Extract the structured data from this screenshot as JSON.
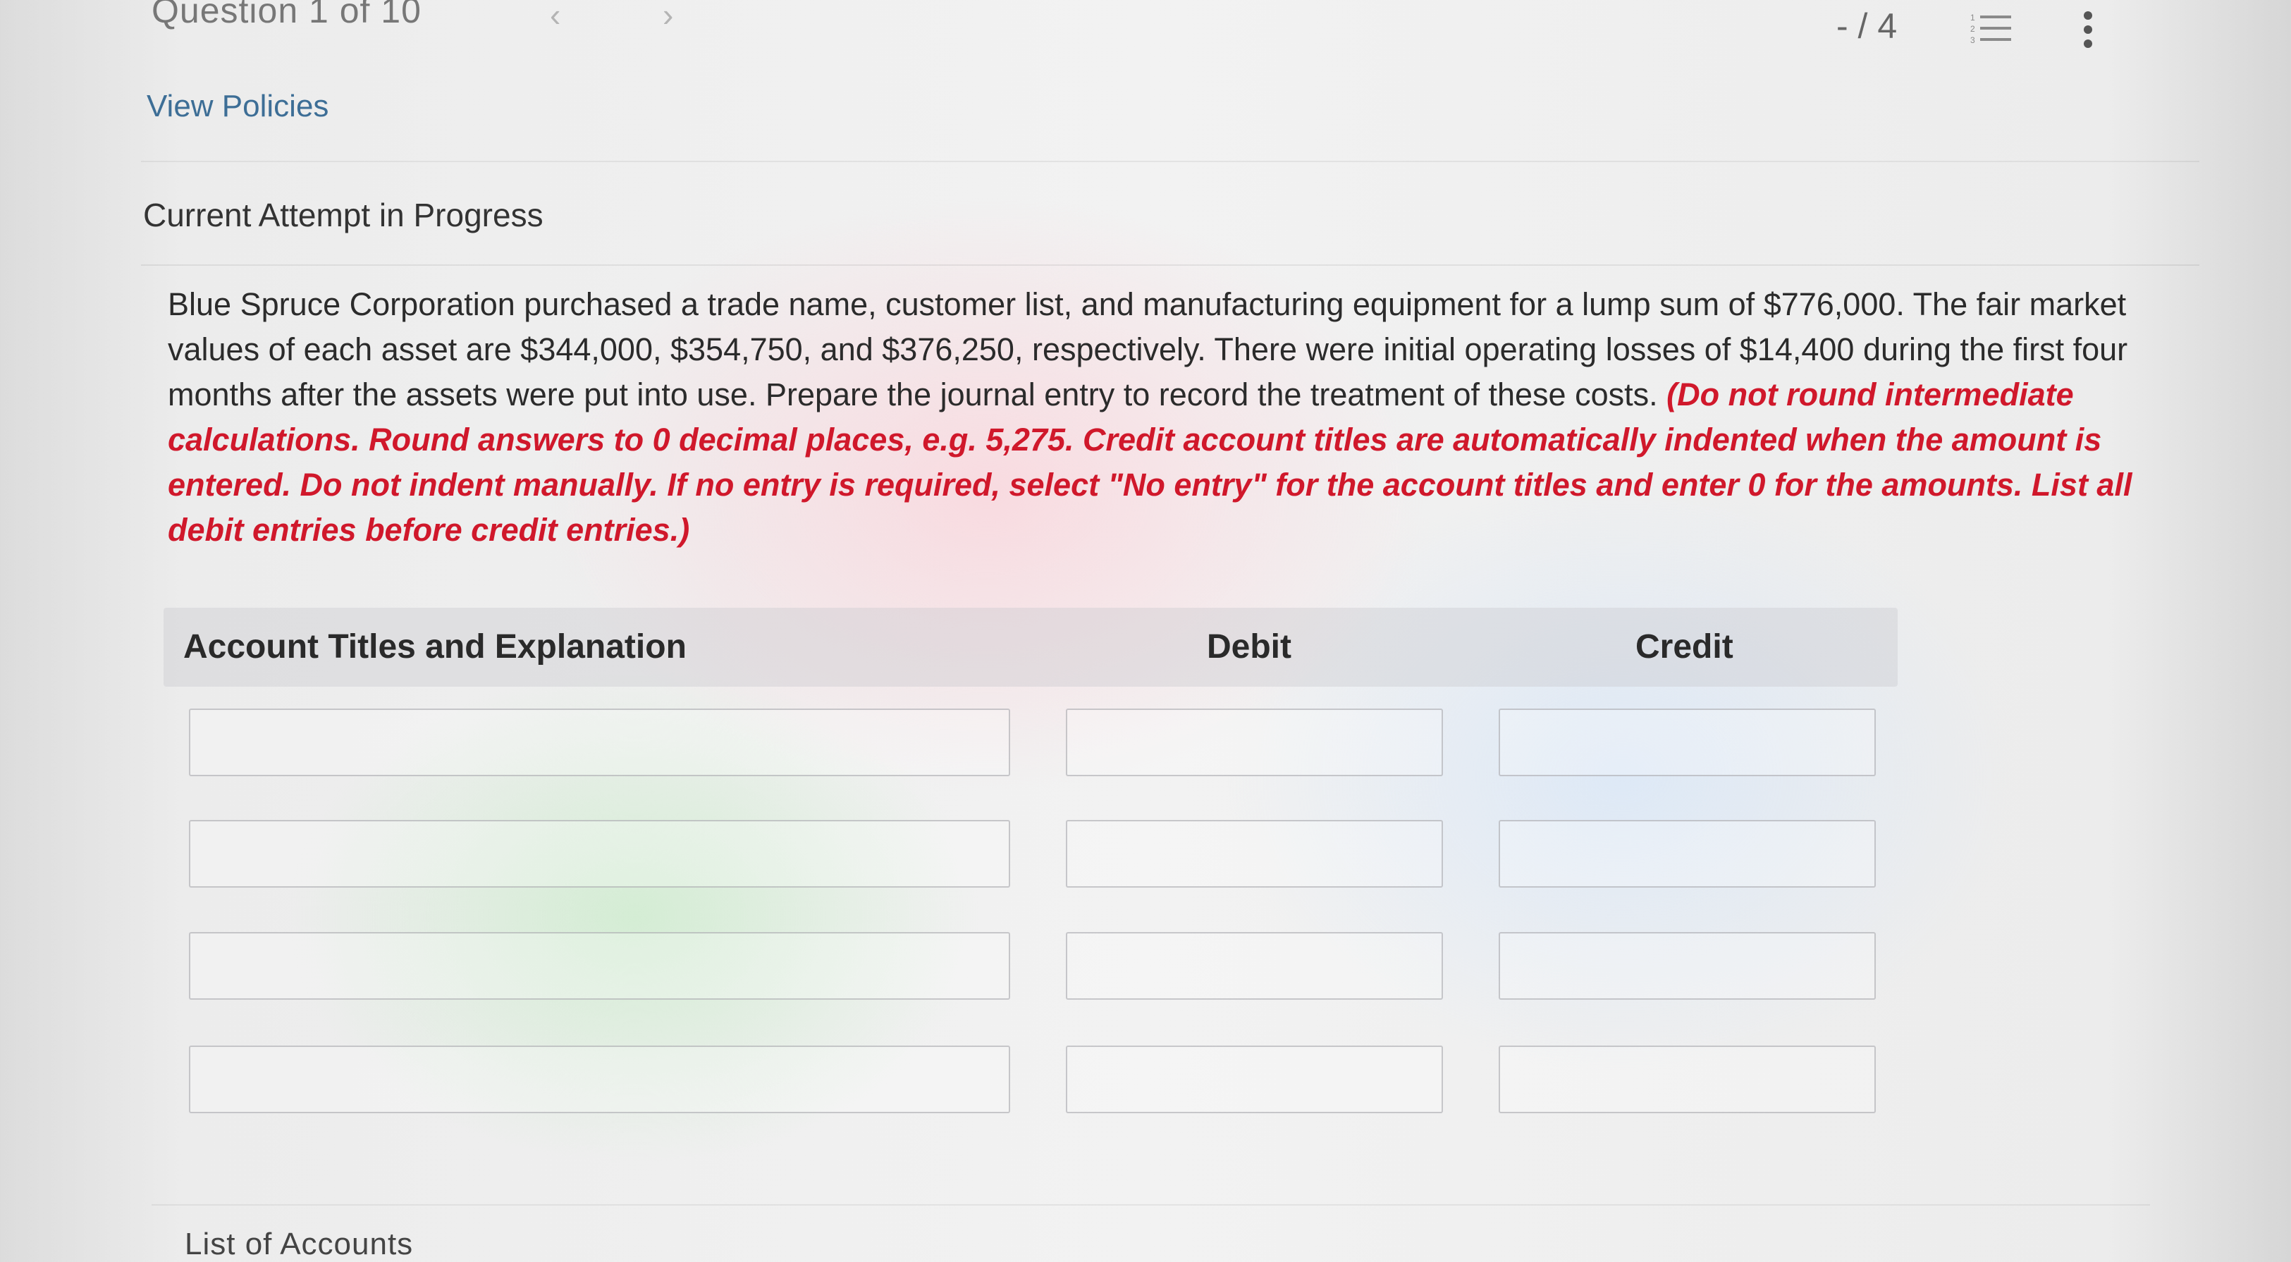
{
  "header": {
    "question_counter": "Question 1 of 10",
    "prev_glyph": "‹",
    "next_glyph": "›",
    "score": "- / 4",
    "list_icon": "numbered-list-icon",
    "more_icon": "vertical-ellipsis-icon"
  },
  "policies_link": "View Policies",
  "attempt_heading": "Current Attempt in Progress",
  "question": {
    "body": "Blue Spruce Corporation purchased a trade name, customer list, and manufacturing equipment for a lump sum of $776,000. The fair market values of each asset are $344,000, $354,750, and $376,250, respectively. There were initial operating losses of $14,400 during the first four months after the assets were put into use. Prepare the journal entry to record the treatment of these costs.",
    "instructions": "(Do not round intermediate calculations. Round answers to 0 decimal places, e.g. 5,275. Credit account titles are automatically indented when the amount is entered. Do not indent manually. If no entry is required, select \"No entry\" for the account titles and enter 0 for the amounts. List all debit entries before credit entries.)"
  },
  "journal": {
    "columns": {
      "account": "Account Titles and Explanation",
      "debit": "Debit",
      "credit": "Credit"
    },
    "rows": [
      {
        "account": "",
        "debit": "",
        "credit": ""
      },
      {
        "account": "",
        "debit": "",
        "credit": ""
      },
      {
        "account": "",
        "debit": "",
        "credit": ""
      },
      {
        "account": "",
        "debit": "",
        "credit": ""
      }
    ]
  },
  "list_of_accounts_label": "List of Accounts",
  "colors": {
    "instruction_red": "#d0182b",
    "link_blue": "#3d6e96"
  }
}
